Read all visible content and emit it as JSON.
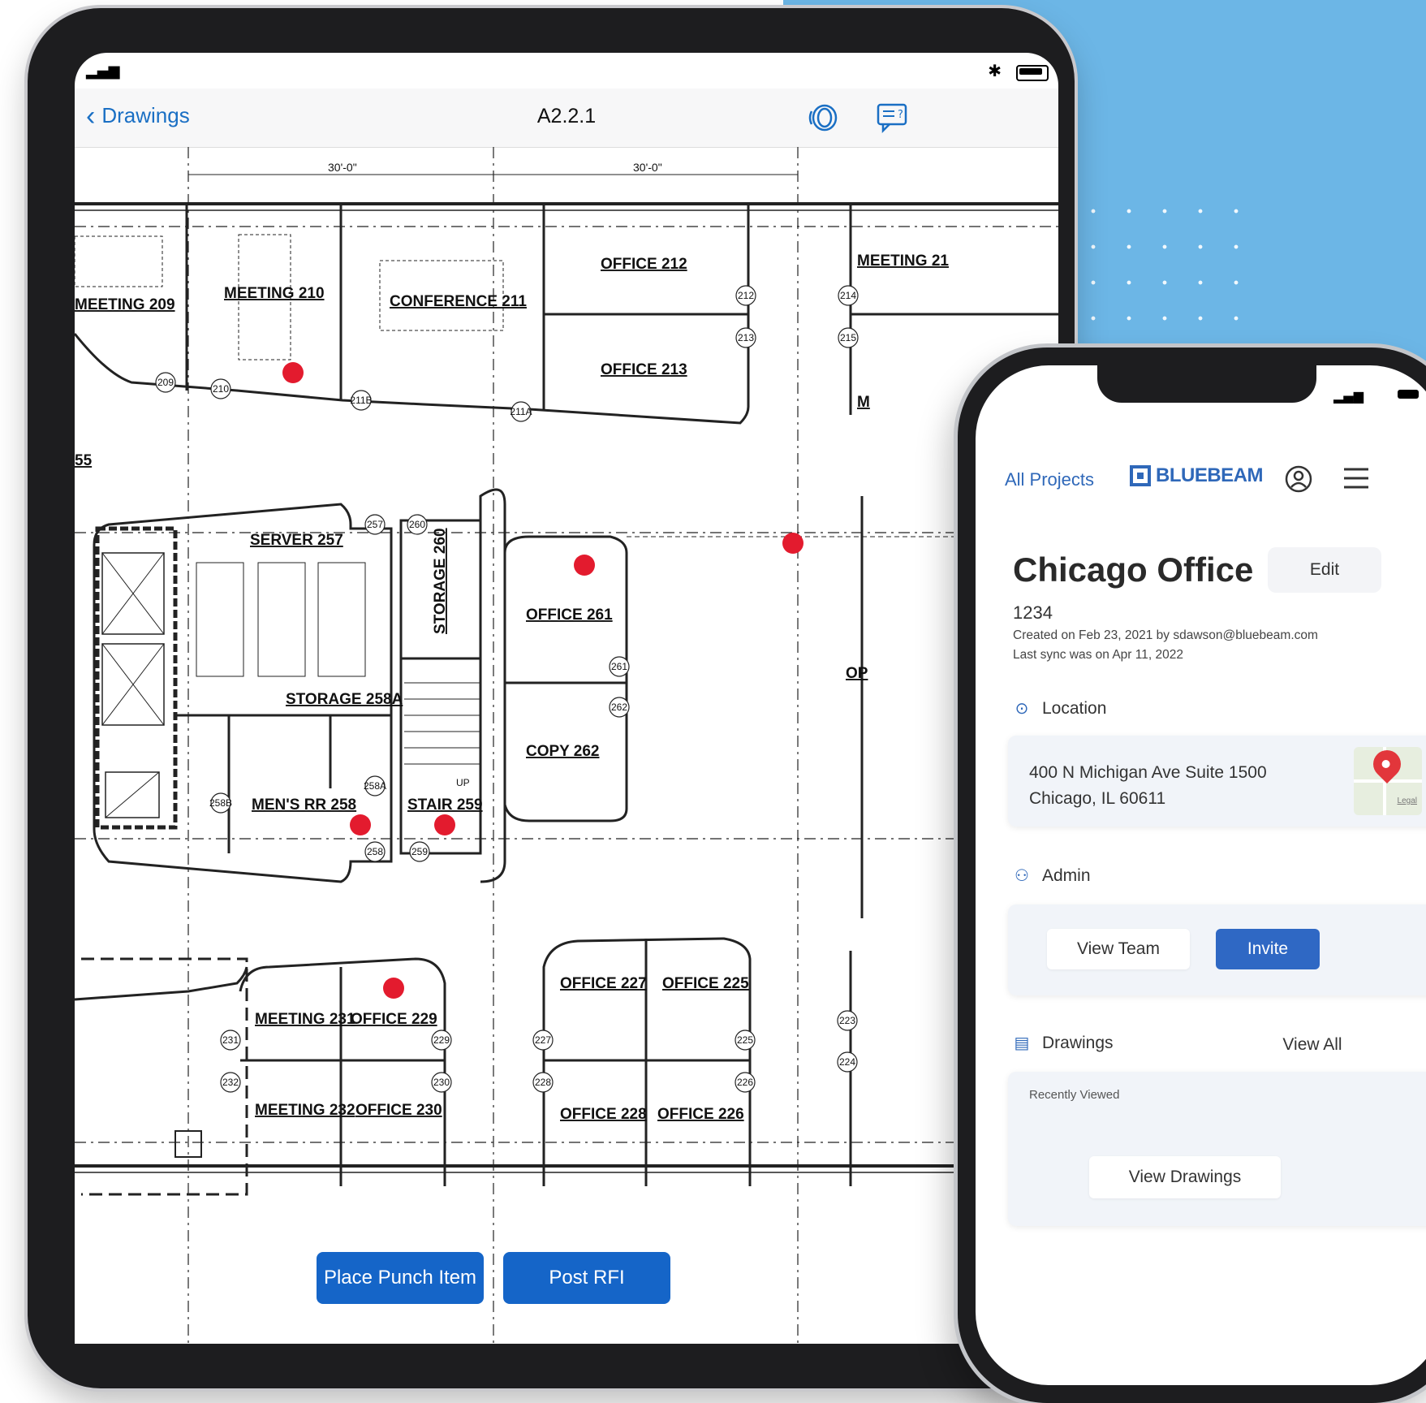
{
  "tablet": {
    "status": {
      "signal": "📶",
      "bluetooth": "✱"
    },
    "nav": {
      "back_label": "Drawings",
      "title": "A2.2.1",
      "icons": [
        "layers-icon",
        "rfi-chat-icon"
      ]
    },
    "plan": {
      "dimensions": [
        "30'-0\"",
        "30'-0\""
      ],
      "rooms": [
        "MEETING  209",
        "MEETING  210",
        "CONFERENCE  211",
        "OFFICE  212",
        "OFFICE  213",
        "MEETING  21",
        "SERVER  257",
        "STORAGE  260",
        "OFFICE  261",
        "STORAGE  258A",
        "COPY  262",
        "MEN'S RR  258",
        "STAIR  259",
        "MEETING  231",
        "OFFICE  229",
        "OFFICE  227",
        "OFFICE  225",
        "MEETING  232",
        "OFFICE  230",
        "OFFICE  228",
        "OFFICE  226",
        "55",
        "OP",
        "M"
      ],
      "door_tags": [
        "209",
        "210",
        "211B",
        "211A",
        "212",
        "213",
        "214",
        "215",
        "257",
        "260",
        "261",
        "262",
        "258A",
        "258B",
        "258",
        "259",
        "231",
        "232",
        "229",
        "230",
        "227",
        "228",
        "225",
        "226",
        "223",
        "224"
      ],
      "stair_label": "UP",
      "punch_marker_color": "#e31b2e"
    },
    "actions": {
      "place_punch": "Place Punch Item",
      "post_rfi": "Post RFI"
    }
  },
  "phone": {
    "header": {
      "all_projects": "All Projects",
      "brand": "BLUEBEAM",
      "icons": [
        "user-icon",
        "menu-icon"
      ]
    },
    "project": {
      "title": "Chicago Office",
      "edit": "Edit",
      "number": "1234",
      "created": "Created on Feb 23, 2021 by sdawson@bluebeam.com",
      "last_sync": "Last sync was on Apr 11, 2022"
    },
    "location": {
      "heading": "Location",
      "line1": "400 N Michigan Ave Suite 1500",
      "line2": "Chicago, IL 60611",
      "map_legal": "Legal"
    },
    "admin": {
      "heading": "Admin",
      "view_team": "View Team",
      "invite": "Invite"
    },
    "drawings": {
      "heading": "Drawings",
      "view_all": "View All",
      "recent": "Recently Viewed",
      "view_drawings": "View Drawings"
    }
  },
  "colors": {
    "accent": "#1565c8",
    "brand": "#2f68b9",
    "background": "#6cb6e6",
    "punch": "#e31b2e"
  }
}
